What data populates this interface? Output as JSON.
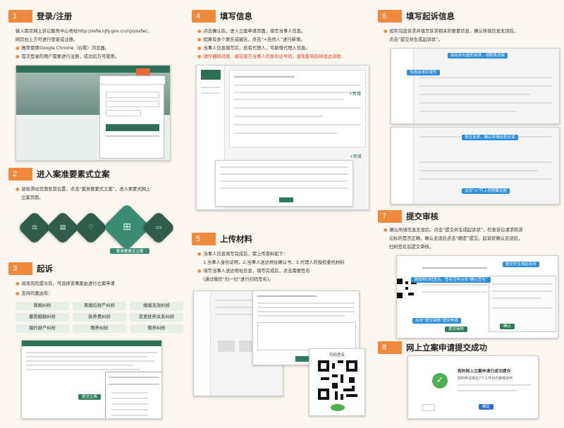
{
  "sections": [
    {
      "num": "1",
      "title": "登录/注册",
      "lines": [
        "输入南京网上诉讼服务中心地址http://ssfw.njfy.gov.cn/njzyssfw/，",
        "网页右上方可进行登录或注册。",
        "推荐使用Google Chrome（谷歌）浏览器。",
        "首次登录的用户需要进行注册，成功后方可使用。"
      ]
    },
    {
      "num": "2",
      "title": "进入案准要素式立案",
      "lines": [
        "鼠标滑动页面至其位置，点击“案准要素式立案”，进入要素式网上",
        "立案页面。"
      ],
      "hex_label": "案准要素式立案"
    },
    {
      "num": "3",
      "title": "起诉",
      "lines": [
        "阅读风险提示后，可选择该事案由进行立案申请",
        "支持的案由有："
      ],
      "cases": [
        "离婚纠纷",
        "离婚后财产纠纷",
        "婚姻无效纠纷",
        "撤销婚姻纠纷",
        "抚养费纠纷",
        "变更抚养关系纠纷",
        "婚约财产纠纷",
        "赡养纠纷",
        "赠养纠纷"
      ],
      "btn": "提交立案"
    },
    {
      "num": "4",
      "title": "填写信息",
      "lines": [
        "点击确认后，进入立案申请页面，填写当事人信息。",
        "如果有多个原告或被告，点击“+自然人”进行新增。",
        "当事人信息填写后，若有代理人，可新增代理人信息。"
      ],
      "warn": "请仔细核对原、被告双方当事人的身份证号码，避免影响后续送达流程",
      "add1": "+新增",
      "add2": "+新增"
    },
    {
      "num": "5",
      "title": "上传材料",
      "lines": [
        "当事人信息填写完成后，需上传资料如下：",
        "1.当事人身份证明，2.当事人送达地址确认书，3.代理人的授权委托材料",
        "填写当事人送达地址信息，填写完成后，点击需要签名",
        "(通过微信“扫一扫”进行扫码签名)。"
      ],
      "qr_title": "扫码签名"
    },
    {
      "num": "6",
      "title": "填写起诉信息",
      "lines": [
        "如实勾选诉求并填写诉求相关的要素信息，确认所填信息无误后，",
        "点击“提交并生成起诉状”。"
      ],
      "tags": [
        "如有未勾选的诉求，请联系法院",
        "勾选诉求并填写",
        "各位诉求，确认所填信息无误",
        "点击“+”可上传附属证据"
      ]
    },
    {
      "num": "7",
      "title": "提交审核",
      "lines": [
        "确认所填信息无误后，点击“提交并生成起诉状”，检查诉讼请求和诉",
        "讼标的是否正确，确认无误后点击“确定”提交。起诉状确认无误后，",
        "扫码签名后提交审核。"
      ],
      "tags": [
        "提交并生成起诉状",
        "请使用扫码签名，签名完毕点击“确认签名”",
        "点击“提交审核”提交申请",
        "提交审核",
        "确认"
      ]
    },
    {
      "num": "8",
      "title": "网上立案申请提交成功",
      "success_title": "您的网上立案申请已成功提交",
      "success_text": "您的申请将在7个工作日内审核完毕",
      "success_btn": "确定"
    }
  ]
}
